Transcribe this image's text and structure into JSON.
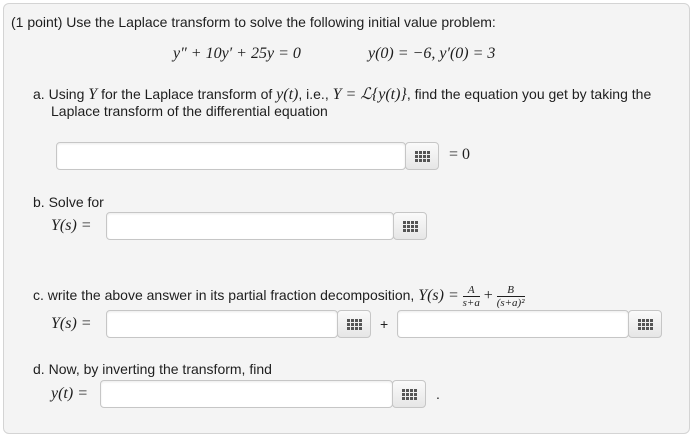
{
  "header": {
    "points": "(1 point)",
    "prompt": "Use the Laplace transform to solve the following initial value problem:"
  },
  "equation": {
    "ode": "y″ + 10y′ + 25y = 0",
    "ics": "y(0) = −6,  y′(0) = 3"
  },
  "part_a": {
    "letter": "a.",
    "text1": "Using",
    "Y": "Y",
    "text2": "for the Laplace transform of",
    "yt": "y(t)",
    "text3": ", i.e.,",
    "def": "Y = ℒ{y(t)}",
    "text4": ", find the equation you get by taking the",
    "line2": "Laplace transform of the differential equation",
    "suffix": "= 0"
  },
  "part_b": {
    "letter": "b.",
    "text": "Solve for",
    "label": "Y(s) ="
  },
  "part_c": {
    "letter": "c.",
    "text": "write the above answer in its partial fraction decomposition,",
    "lhs": "Y(s) =",
    "A": "A",
    "den1": "s+a",
    "plus": "+",
    "B": "B",
    "den2": "(s+a)²",
    "label": "Y(s) =",
    "sep": "+"
  },
  "part_d": {
    "letter": "d.",
    "text": "Now, by inverting the transform, find",
    "label": "y(t) =",
    "period": "."
  },
  "inputs": {
    "a": "",
    "b": "",
    "c1": "",
    "c2": "",
    "d": ""
  }
}
